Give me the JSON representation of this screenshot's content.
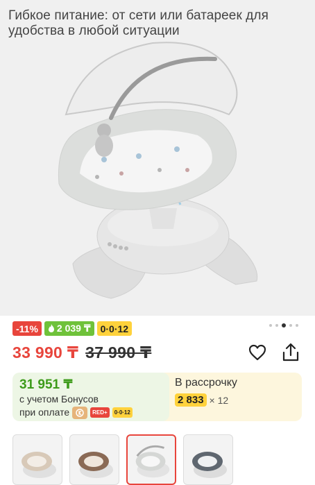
{
  "hero": {
    "caption": "Гибкое питание: от сети или батареек для удобства в любой ситуации"
  },
  "badges": {
    "discount": "-11%",
    "bonus": "2 039 ₸",
    "installment": "0·0·12"
  },
  "gallery": {
    "count": 5,
    "active_index": 3
  },
  "price": {
    "current": "33 990 ₸",
    "old": "37 990 ₸"
  },
  "bonus_card": {
    "price": "31 951 ₸",
    "line1": "с учетом Бонусов",
    "line2": "при оплате",
    "badge_red": "RED+",
    "badge_yellow": "0·0·12"
  },
  "installment_card": {
    "title": "В рассрочку",
    "amount": "2 833",
    "multiplier": "× 12"
  },
  "colors": {
    "accent_red": "#e8453c",
    "bonus_green": "#6fc23a",
    "installment_yellow": "#ffd23c"
  },
  "icons": {
    "favorite": "heart-icon",
    "share": "share-icon"
  }
}
